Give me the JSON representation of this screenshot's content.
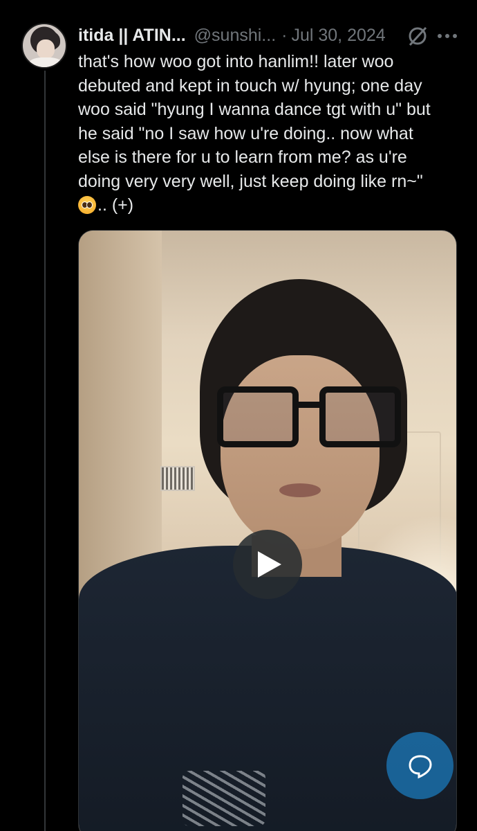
{
  "post": {
    "display_name": "itida || ATIN...",
    "handle": "@sunshi...",
    "separator": "·",
    "date": "Jul 30, 2024",
    "text_lines": [
      "that's how woo got into hanlim!! later woo",
      "debuted and kept in touch w/ hyung; one day",
      "woo said \"hyung I wanna dance tgt with u\" but",
      "he said \"no I saw how u're doing.. now what",
      "else is there for u to learn from me? as u're",
      "doing very very well, just keep doing like rn~\"",
      ".. (+)"
    ],
    "emoji": "pleading-face-emoji",
    "icons": {
      "avatar": "user-avatar",
      "grok": "grok-icon",
      "more": "more-options-icon",
      "play": "play-icon",
      "reply": "reply-bubble-icon"
    }
  },
  "media": {
    "type": "video-thumbnail"
  },
  "colors": {
    "background": "#000000",
    "text": "#e7e9ea",
    "secondary_text": "#71767b",
    "accent": "#1d9bf0"
  }
}
